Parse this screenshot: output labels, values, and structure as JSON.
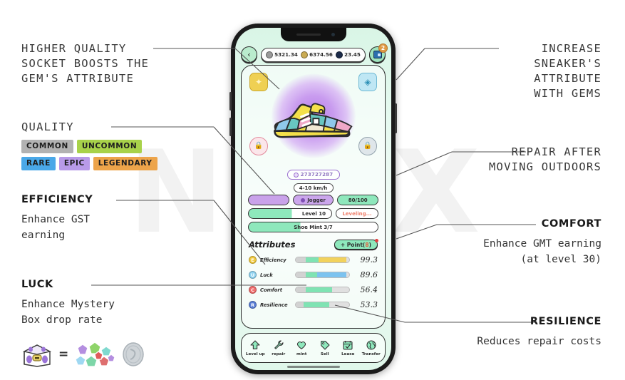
{
  "watermark": "NFTX",
  "annotations": {
    "socket": {
      "lines": [
        "HIGHER QUALITY",
        "SOCKET BOOSTS THE",
        "GEM'S ATTRIBUTE"
      ]
    },
    "quality": {
      "title": "QUALITY"
    },
    "efficiency": {
      "title": "EFFICIENCY",
      "body": [
        "Enhance GST",
        "earning"
      ]
    },
    "luck": {
      "title": "LUCK",
      "body": [
        "Enhance Mystery",
        "Box drop rate"
      ],
      "equals": "="
    },
    "gems": {
      "lines": [
        "INCREASE",
        "SNEAKER'S",
        "ATTRIBUTE",
        "WITH GEMS"
      ]
    },
    "repair": {
      "lines": [
        "REPAIR AFTER",
        "MOVING OUTDOORS"
      ]
    },
    "comfort": {
      "title": "COMFORT",
      "body": [
        "Enhance GMT earning",
        "(at level 30)"
      ]
    },
    "resilience": {
      "title": "RESILIENCE",
      "body": [
        "Reduces repair costs"
      ]
    }
  },
  "quality_chips": [
    {
      "label": "COMMON",
      "color": "#b2b2b2"
    },
    {
      "label": "UNCOMMON",
      "color": "#a8d24a"
    },
    {
      "label": "RARE",
      "color": "#4aa8e8"
    },
    {
      "label": "EPIC",
      "color": "#b89ae8"
    },
    {
      "label": "LEGENDARY",
      "color": "#eda44a"
    }
  ],
  "app": {
    "back_label": "‹",
    "currencies": [
      {
        "name": "silver-coin",
        "value": "5321.34",
        "color": "#9a9a9a"
      },
      {
        "name": "gold-coin",
        "value": "6374.56",
        "color": "#c9aa52"
      },
      {
        "name": "gmt-coin",
        "value": "23.45",
        "color": "#1c2b4a"
      }
    ],
    "inventory_badge": "2",
    "sockets": [
      {
        "name": "socket-legendary",
        "quality": "LEGENDARY",
        "glyph": "✦",
        "locked": false
      },
      {
        "name": "socket-gem-blue",
        "quality": "RARE",
        "glyph": "◈",
        "locked": false
      },
      {
        "name": "socket-locked-pink",
        "quality": "",
        "glyph": "🔒",
        "locked": true
      },
      {
        "name": "socket-locked-gray",
        "quality": "",
        "glyph": "🔒",
        "locked": true
      }
    ],
    "shoe_id": "273727287",
    "speed": "4-10 km/h",
    "rows": [
      {
        "left": "",
        "mid": "Jogger",
        "right": "80/100"
      },
      {
        "left": "",
        "mid": "Level 10",
        "right": "Leveling..."
      },
      {
        "left": "",
        "mid": "Shoe Mint 3/7",
        "right": ""
      }
    ],
    "attributes_title": "Attributes",
    "point_button": {
      "prefix": "+ Point(",
      "count": "8",
      "suffix": ")"
    },
    "attributes": [
      {
        "name": "Efficiency",
        "value": "99.3",
        "icon": "E",
        "icon_color": "#f0c93f",
        "base": 18,
        "fill": 24,
        "bonus": 52,
        "bonus_color": "#f2d25c"
      },
      {
        "name": "Luck",
        "value": "89.6",
        "icon": "U",
        "icon_color": "#8fd3f0",
        "base": 18,
        "fill": 22,
        "bonus": 54,
        "bonus_color": "#7cc3ef"
      },
      {
        "name": "Comfort",
        "value": "56.4",
        "icon": "C",
        "icon_color": "#ef6b6b",
        "base": 18,
        "fill": 50,
        "bonus": 0,
        "bonus_color": "#ffffff"
      },
      {
        "name": "Resilience",
        "value": "53.3",
        "icon": "R",
        "icon_color": "#5b7fd6",
        "base": 14,
        "fill": 48,
        "bonus": 0,
        "bonus_color": "#ffffff"
      }
    ],
    "nav": [
      {
        "label": "Level up",
        "icon": "arrow-up-icon"
      },
      {
        "label": "repair",
        "icon": "wrench-icon"
      },
      {
        "label": "mint",
        "icon": "heart-icon"
      },
      {
        "label": "Sell",
        "icon": "tag-icon"
      },
      {
        "label": "Lease",
        "icon": "calendar-icon"
      },
      {
        "label": "Transfer",
        "icon": "globe-icon"
      }
    ]
  }
}
